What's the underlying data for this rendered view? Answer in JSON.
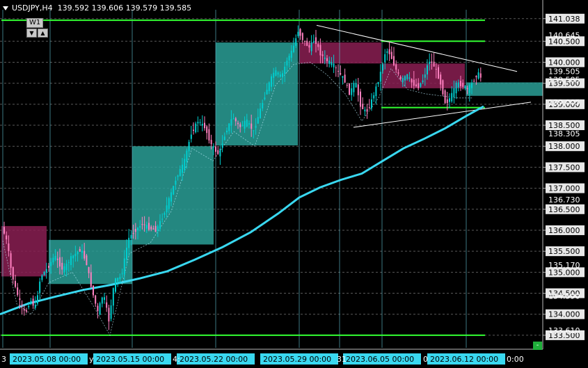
{
  "header": {
    "symbol_tf": "USDJPY,H4",
    "ohlc": "139.592 139.606 139.579 139.585"
  },
  "timeframe_badge": "W1",
  "scroll_buttons": {
    "down": "▼",
    "up": "▲"
  },
  "colors": {
    "background": "#000000",
    "grid": "#5a5a5a",
    "bull": "#00cfd0",
    "bear": "#ff80c0",
    "zone_bull": "#2a9f96",
    "zone_bear": "#8a1e52",
    "level_line": "#33ff33",
    "ma": "#39d8f0",
    "trendline": "#ffffff",
    "date_label_bg": "#39d8f0"
  },
  "chart_data": {
    "type": "candlestick",
    "symbol": "USDJPY",
    "timeframe": "H4",
    "ylim": [
      133.2,
      141.25
    ],
    "y_ticks": [
      133.5,
      134.0,
      134.5,
      135.0,
      135.5,
      136.0,
      136.5,
      137.0,
      137.5,
      138.0,
      138.5,
      139.0,
      139.5,
      140.0,
      140.5,
      141.038
    ],
    "y_tick_labels": [
      "133.500",
      "134.000",
      "134.500",
      "135.000",
      "135.500",
      "136.000",
      "136.500",
      "137.000",
      "137.500",
      "138.000",
      "138.500",
      "139.000",
      "139.500",
      "140.000",
      "140.500",
      "141.038"
    ],
    "extra_price_labels": [
      {
        "label": "133.610",
        "value": 133.61
      },
      {
        "label": "134.590",
        "value": 134.43
      },
      {
        "label": "135.170",
        "value": 135.17
      },
      {
        "label": "136.730",
        "value": 136.73
      },
      {
        "label": "138.305",
        "value": 138.305
      },
      {
        "label": "139.005",
        "value": 139.05
      },
      {
        "label": "139.585",
        "value": 139.585
      },
      {
        "label": "139.505",
        "value": 139.78
      },
      {
        "label": "140.645",
        "value": 140.645
      }
    ],
    "x_labels": [
      "2023.05.08 00:00",
      "2023.05.15 00:00",
      "2023.05.22 00:00",
      "2023.05.29 00:00",
      "2023.06.05 00:00",
      "2023.06.12 00:00"
    ],
    "x_partial_labels": [
      "3",
      "y",
      "4:",
      "31",
      "0",
      "0:00"
    ],
    "daily_separators_x": [
      4,
      72,
      190,
      310,
      430,
      488,
      549,
      670
    ],
    "horizontal_levels": [
      133.5,
      141.0,
      140.5,
      138.92
    ],
    "zones": [
      {
        "kind": "bear",
        "x0": 2,
        "x1": 67,
        "top": 136.1,
        "bottom": 134.9
      },
      {
        "kind": "bull",
        "x0": 70,
        "x1": 190,
        "top": 135.77,
        "bottom": 134.72
      },
      {
        "kind": "bull",
        "x0": 190,
        "x1": 307,
        "top": 138.0,
        "bottom": 135.66
      },
      {
        "kind": "bull",
        "x0": 310,
        "x1": 428,
        "top": 140.47,
        "bottom": 138.02
      },
      {
        "kind": "bear",
        "x0": 430,
        "x1": 548,
        "top": 140.47,
        "bottom": 139.97
      },
      {
        "kind": "bear",
        "x0": 549,
        "x1": 668,
        "top": 139.97,
        "bottom": 139.38
      },
      {
        "kind": "bull",
        "x0": 670,
        "x1": 780,
        "top": 139.52,
        "bottom": 139.2
      }
    ],
    "trendlines": [
      {
        "x0": 455,
        "y0": 140.88,
        "x1": 743,
        "y1": 139.78
      },
      {
        "x0": 508,
        "y0": 138.45,
        "x1": 763,
        "y1": 139.05
      }
    ],
    "ma_curve": [
      [
        0,
        134.0
      ],
      [
        40,
        134.25
      ],
      [
        80,
        134.42
      ],
      [
        120,
        134.58
      ],
      [
        160,
        134.7
      ],
      [
        200,
        134.85
      ],
      [
        240,
        135.02
      ],
      [
        280,
        135.3
      ],
      [
        320,
        135.6
      ],
      [
        360,
        135.95
      ],
      [
        400,
        136.4
      ],
      [
        430,
        136.78
      ],
      [
        460,
        137.02
      ],
      [
        490,
        137.2
      ],
      [
        520,
        137.35
      ],
      [
        550,
        137.65
      ],
      [
        580,
        137.95
      ],
      [
        610,
        138.18
      ],
      [
        640,
        138.43
      ],
      [
        670,
        138.72
      ],
      [
        695,
        138.95
      ]
    ],
    "price_path": [
      [
        4,
        136.1
      ],
      [
        12,
        135.7
      ],
      [
        18,
        135.0
      ],
      [
        24,
        134.6
      ],
      [
        30,
        134.3
      ],
      [
        38,
        134.0
      ],
      [
        45,
        134.35
      ],
      [
        52,
        134.15
      ],
      [
        60,
        134.9
      ],
      [
        70,
        135.1
      ],
      [
        80,
        135.4
      ],
      [
        92,
        135.05
      ],
      [
        104,
        135.35
      ],
      [
        118,
        135.55
      ],
      [
        126,
        135.2
      ],
      [
        134,
        134.55
      ],
      [
        142,
        134.05
      ],
      [
        150,
        134.5
      ],
      [
        158,
        133.85
      ],
      [
        166,
        134.8
      ],
      [
        176,
        134.9
      ],
      [
        186,
        135.8
      ],
      [
        196,
        136.0
      ],
      [
        206,
        136.15
      ],
      [
        216,
        136.05
      ],
      [
        226,
        136.0
      ],
      [
        236,
        136.35
      ],
      [
        246,
        136.8
      ],
      [
        256,
        137.3
      ],
      [
        266,
        137.6
      ],
      [
        276,
        138.3
      ],
      [
        286,
        138.6
      ],
      [
        296,
        138.45
      ],
      [
        306,
        138.0
      ],
      [
        316,
        137.8
      ],
      [
        326,
        138.35
      ],
      [
        336,
        138.7
      ],
      [
        346,
        138.45
      ],
      [
        356,
        138.6
      ],
      [
        366,
        138.35
      ],
      [
        376,
        138.9
      ],
      [
        386,
        139.4
      ],
      [
        396,
        139.8
      ],
      [
        406,
        139.65
      ],
      [
        414,
        140.05
      ],
      [
        422,
        140.3
      ],
      [
        430,
        140.75
      ],
      [
        438,
        140.5
      ],
      [
        446,
        140.35
      ],
      [
        454,
        140.55
      ],
      [
        462,
        140.2
      ],
      [
        470,
        140.05
      ],
      [
        480,
        139.95
      ],
      [
        488,
        139.75
      ],
      [
        496,
        139.6
      ],
      [
        504,
        139.25
      ],
      [
        512,
        139.55
      ],
      [
        520,
        138.95
      ],
      [
        528,
        138.8
      ],
      [
        536,
        139.1
      ],
      [
        544,
        139.5
      ],
      [
        550,
        139.85
      ],
      [
        556,
        140.3
      ],
      [
        562,
        140.2
      ],
      [
        570,
        139.85
      ],
      [
        578,
        139.55
      ],
      [
        586,
        139.7
      ],
      [
        594,
        139.5
      ],
      [
        602,
        139.4
      ],
      [
        610,
        139.6
      ],
      [
        618,
        140.05
      ],
      [
        626,
        139.9
      ],
      [
        634,
        139.55
      ],
      [
        642,
        139.0
      ],
      [
        650,
        139.2
      ],
      [
        658,
        139.5
      ],
      [
        666,
        139.45
      ],
      [
        674,
        139.35
      ],
      [
        680,
        139.5
      ],
      [
        688,
        139.75
      ],
      [
        694,
        139.6
      ]
    ]
  }
}
